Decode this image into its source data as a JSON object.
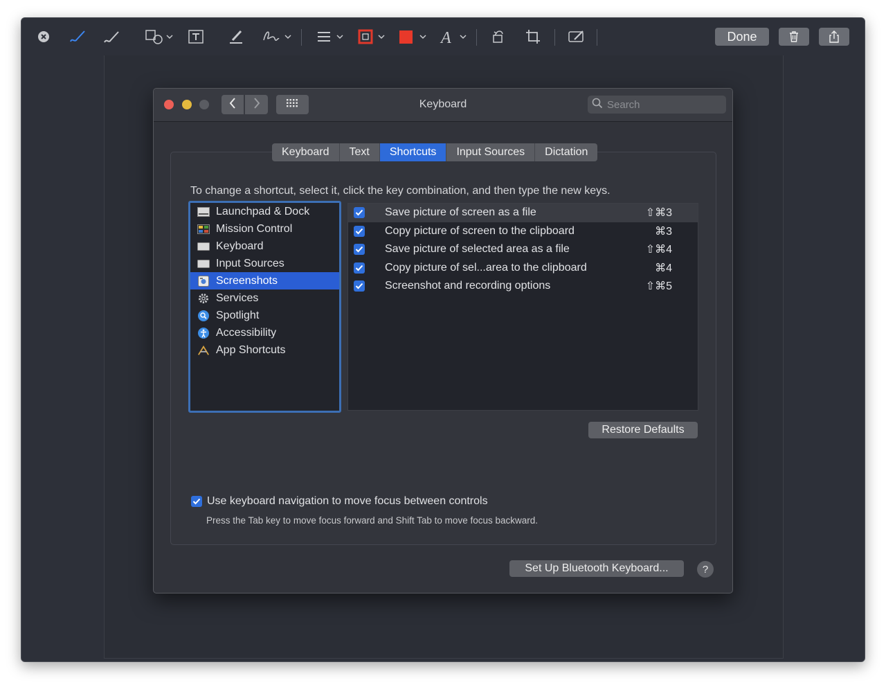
{
  "markup_toolbar": {
    "done_label": "Done",
    "icons": [
      "close-icon",
      "sketch-icon",
      "draw-icon",
      "shapes-icon",
      "textbox-icon",
      "highlight-icon",
      "sign-icon",
      "line-style-icon",
      "border-color-icon",
      "fill-color-icon",
      "text-style-icon",
      "rotate-icon",
      "crop-icon",
      "annotate-icon",
      "trash-icon",
      "share-icon"
    ],
    "colors": {
      "border_color": "#e0392b",
      "fill_color": "#e8392a",
      "sketch_accent": "#3c86f0"
    }
  },
  "window": {
    "title": "Keyboard",
    "search_placeholder": "Search"
  },
  "tabs": [
    {
      "label": "Keyboard",
      "active": false
    },
    {
      "label": "Text",
      "active": false
    },
    {
      "label": "Shortcuts",
      "active": true
    },
    {
      "label": "Input Sources",
      "active": false
    },
    {
      "label": "Dictation",
      "active": false
    }
  ],
  "instruction": "To change a shortcut, select it, click the key combination, and then type the new keys.",
  "categories": [
    {
      "label": "Launchpad & Dock",
      "icon": "launchpad-icon",
      "selected": false
    },
    {
      "label": "Mission Control",
      "icon": "mission-control-icon",
      "selected": false
    },
    {
      "label": "Keyboard",
      "icon": "keyboard-icon",
      "selected": false
    },
    {
      "label": "Input Sources",
      "icon": "input-sources-icon",
      "selected": false
    },
    {
      "label": "Screenshots",
      "icon": "screenshots-icon",
      "selected": true
    },
    {
      "label": "Services",
      "icon": "gear-icon",
      "selected": false
    },
    {
      "label": "Spotlight",
      "icon": "spotlight-icon",
      "selected": false
    },
    {
      "label": "Accessibility",
      "icon": "accessibility-icon",
      "selected": false
    },
    {
      "label": "App Shortcuts",
      "icon": "app-shortcuts-icon",
      "selected": false
    }
  ],
  "shortcuts": [
    {
      "label": "Save picture of screen as a file",
      "keys": "⇧⌘3",
      "checked": true
    },
    {
      "label": "Copy picture of screen to the clipboard",
      "keys": "⌘3",
      "checked": true
    },
    {
      "label": "Save picture of selected area as a file",
      "keys": "⇧⌘4",
      "checked": true
    },
    {
      "label": "Copy picture of sel...area to the clipboard",
      "keys": "⌘4",
      "checked": true
    },
    {
      "label": "Screenshot and recording options",
      "keys": "⇧⌘5",
      "checked": true
    }
  ],
  "restore_defaults_label": "Restore Defaults",
  "kb_nav": {
    "label": "Use keyboard navigation to move focus between controls",
    "hint": "Press the Tab key to move focus forward and Shift Tab to move focus backward.",
    "checked": true
  },
  "bluetooth_label": "Set Up Bluetooth Keyboard...",
  "help_label": "?"
}
